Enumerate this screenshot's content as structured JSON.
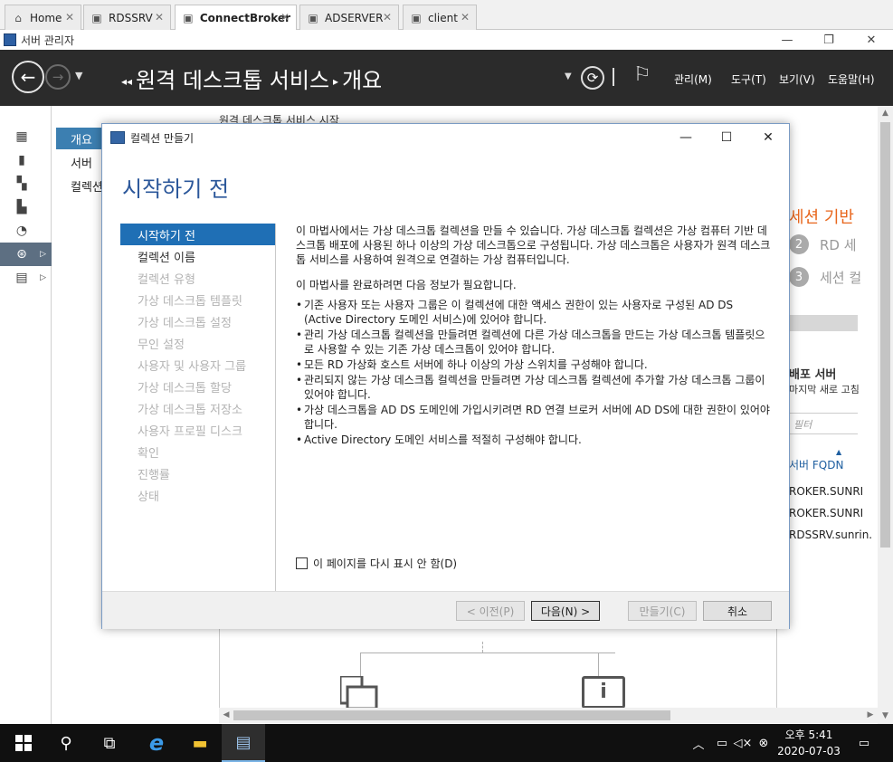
{
  "vm_tabs": [
    {
      "label": "Home",
      "active": false
    },
    {
      "label": "RDSSRV",
      "active": false
    },
    {
      "label": "ConnectBroker",
      "active": true
    },
    {
      "label": "ADSERVER",
      "active": false
    },
    {
      "label": "client",
      "active": false
    }
  ],
  "app": {
    "title": "서버 관리자"
  },
  "header": {
    "breadcrumb_parent": "원격 데스크톱 서비스",
    "breadcrumb_current": "개요",
    "menu": [
      "관리(M)",
      "도구(T)",
      "보기(V)",
      "도움말(H)"
    ]
  },
  "subnav": {
    "items": [
      "개요",
      "서버",
      "컬렉션"
    ]
  },
  "background": {
    "heading": "원격 데스크톱 서비스 시작",
    "orange_title": "세션 기반",
    "steps": [
      {
        "num": "2",
        "label": "RD 세"
      },
      {
        "num": "3",
        "label": "세션 컬"
      }
    ],
    "servers_title": "배포 서버",
    "servers_sub": "마지막 새로 고침",
    "filter_placeholder": "필터",
    "col_header": "서버 FQDN",
    "rows": [
      "ROKER.SUNRI",
      "ROKER.SUNRI",
      "RDSSRV.sunrin."
    ]
  },
  "dialog": {
    "title": "컬렉션 만들기",
    "heading": "시작하기 전",
    "nav_steps": [
      {
        "label": "시작하기 전",
        "state": "active"
      },
      {
        "label": "컬렉션 이름",
        "state": "done"
      },
      {
        "label": "컬렉션 유형",
        "state": "disabled"
      },
      {
        "label": "가상 데스크톱 템플릿",
        "state": "disabled"
      },
      {
        "label": "가상 데스크톱 설정",
        "state": "disabled"
      },
      {
        "label": "무인 설정",
        "state": "disabled"
      },
      {
        "label": "사용자 및 사용자 그룹",
        "state": "disabled"
      },
      {
        "label": "가상 데스크톱 할당",
        "state": "disabled"
      },
      {
        "label": "가상 데스크톱 저장소",
        "state": "disabled"
      },
      {
        "label": "사용자 프로필 디스크",
        "state": "disabled"
      },
      {
        "label": "확인",
        "state": "disabled"
      },
      {
        "label": "진행률",
        "state": "disabled"
      },
      {
        "label": "상태",
        "state": "disabled"
      }
    ],
    "intro": "이 마법사에서는 가상 데스크톱 컬렉션을 만들 수 있습니다. 가상 데스크톱 컬렉션은 가상 컴퓨터 기반 데스크톱 배포에 사용된 하나 이상의 가상 데스크톱으로 구성됩니다. 가상 데스크톱은 사용자가 원격 데스크톱 서비스를 사용하여 원격으로 연결하는 가상 컴퓨터입니다.",
    "requirements_intro": "이 마법사를 완료하려면 다음 정보가 필요합니다.",
    "requirements": [
      "기존 사용자 또는 사용자 그룹은 이 컬렉션에 대한 액세스 권한이 있는 사용자로 구성된 AD DS (Active Directory 도메인 서비스)에 있어야 합니다.",
      "관리 가상 데스크톱 컬렉션을 만들려면 컬렉션에 다른 가상 데스크톱을 만드는 가상 데스크톱 템플릿으로 사용할 수 있는 기존 가상 데스크톱이 있어야 합니다.",
      "모든 RD 가상화 호스트 서버에 하나 이상의 가상 스위치를 구성해야 합니다.",
      "관리되지 않는 가상 데스크톱 컬렉션을 만들려면 가상 데스크톱 컬렉션에 추가할 가상 데스크톱 그룹이 있어야 합니다.",
      "가상 데스크톱을 AD DS 도메인에 가입시키려면 RD 연결 브로커 서버에 AD DS에 대한 권한이 있어야 합니다.",
      "Active Directory 도메인 서비스를 적절히 구성해야 합니다."
    ],
    "checkbox_label": "이 페이지를 다시 표시 안 함(D)",
    "buttons": {
      "prev": "< 이전(P)",
      "next": "다음(N) >",
      "create": "만들기(C)",
      "cancel": "취소"
    }
  },
  "taskbar": {
    "time": "오후 5:41",
    "date": "2020-07-03"
  },
  "colors": {
    "header_bg": "#2b2b2b",
    "accent_blue": "#1f6fb5",
    "heading_blue": "#2b579a",
    "orange": "#e8661c"
  }
}
